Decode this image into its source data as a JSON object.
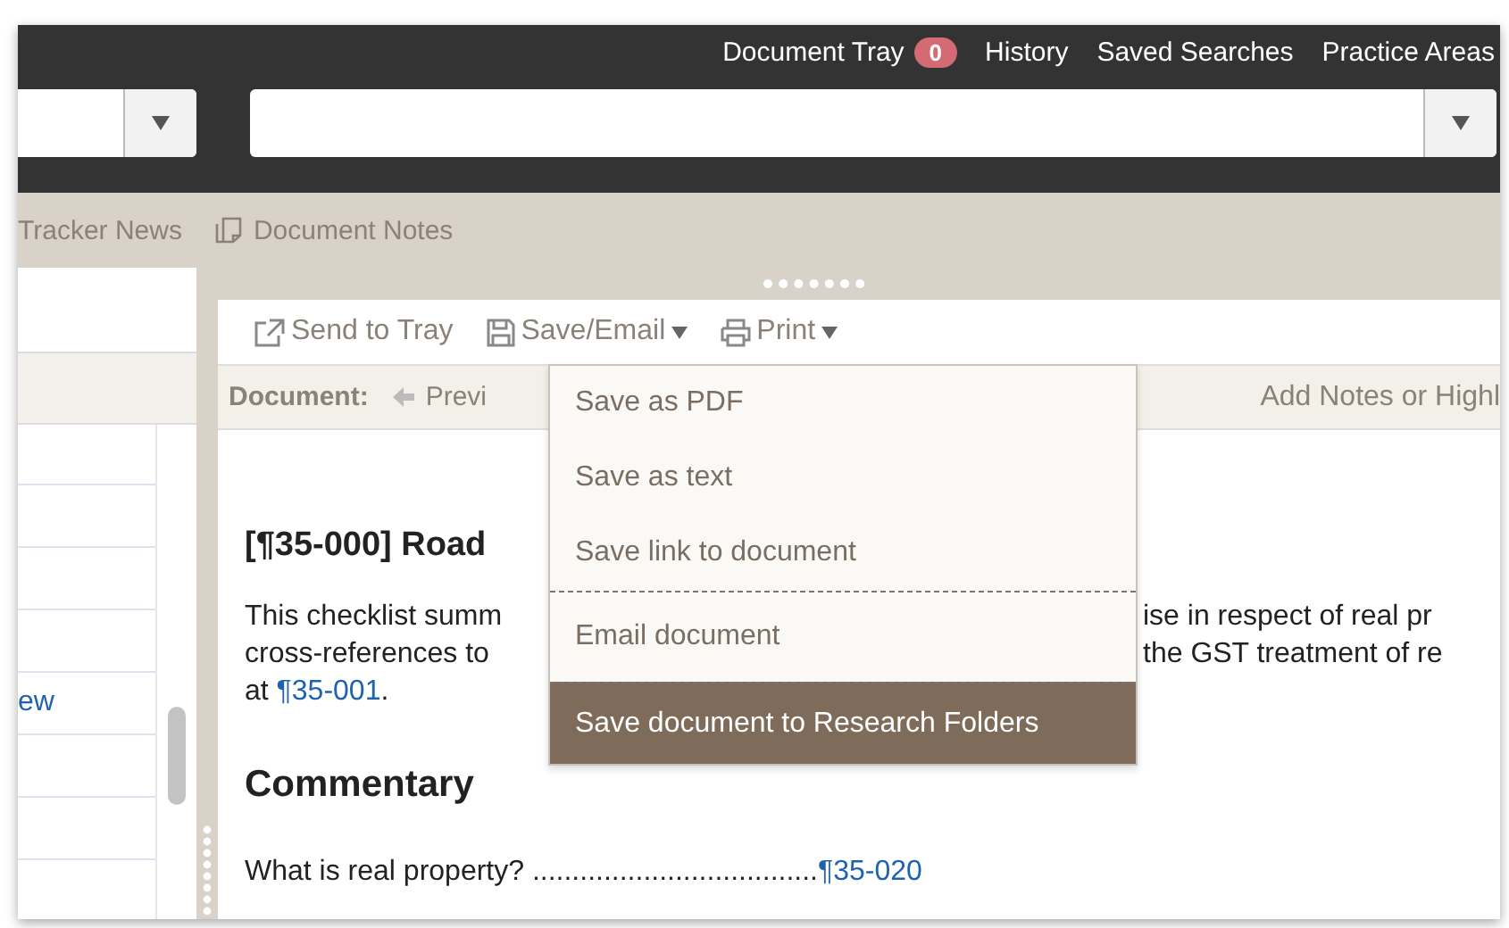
{
  "top_nav": {
    "items": [
      {
        "label": "Document Tray",
        "badge": "0"
      },
      {
        "label": "History"
      },
      {
        "label": "Saved Searches"
      },
      {
        "label": "Practice Areas"
      }
    ]
  },
  "tabs": [
    {
      "label": "Tracker News",
      "kind": "plain"
    },
    {
      "label": "Document Notes",
      "kind": "notes"
    }
  ],
  "toolbar": {
    "items": [
      {
        "label": "Send to Tray",
        "kind": "send",
        "menu": false
      },
      {
        "label": "Save/Email",
        "kind": "save",
        "menu": true
      },
      {
        "label": "Print",
        "kind": "print",
        "menu": true
      }
    ]
  },
  "document_bar": {
    "label": "Document:",
    "previous": "Previ",
    "notes": "Add Notes or Highl"
  },
  "save_menu": {
    "items": [
      {
        "label": "Save as PDF",
        "selected": false,
        "divider_before": false
      },
      {
        "label": "Save as text",
        "selected": false,
        "divider_before": false
      },
      {
        "label": "Save link to document",
        "selected": false,
        "divider_before": false
      },
      {
        "label": "Email document",
        "selected": false,
        "divider_before": true
      },
      {
        "label": "Save document to Research Folders",
        "selected": true,
        "divider_before": true
      }
    ]
  },
  "left_panel": {
    "link": "ew"
  },
  "document": {
    "heading": "[¶35-000] Road",
    "paragraph_lines": [
      {
        "left": "This checklist summ",
        "right": "ise in respect of real pr"
      },
      {
        "left": "cross-references to",
        "right": "the GST treatment of re"
      }
    ],
    "paragraph_end": {
      "text": "at ",
      "link": "¶35-001",
      "after": "."
    },
    "section": "Commentary",
    "toc": [
      {
        "question": "What is real property? ....................................",
        "ref": "¶35-020"
      }
    ]
  }
}
